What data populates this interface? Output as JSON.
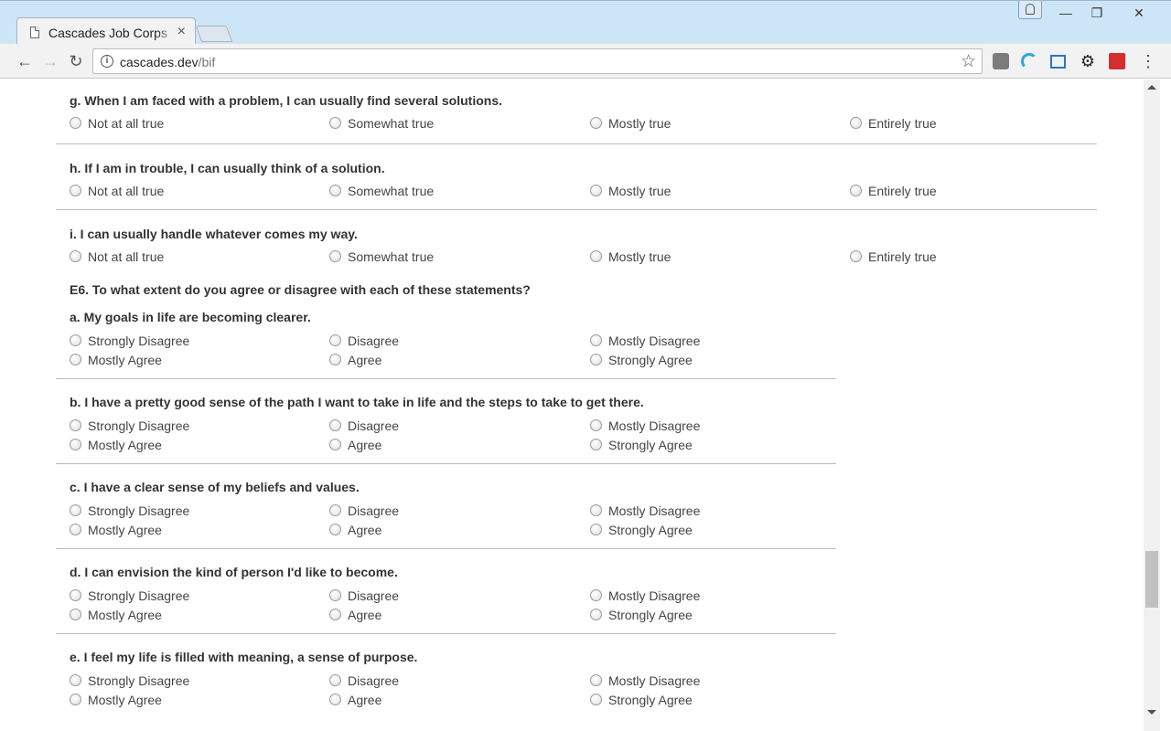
{
  "browser": {
    "tab_title": "Cascades Job Corps",
    "tab_close": "×",
    "url_host": "cascades.dev",
    "url_path": "/bif",
    "window_buttons": {
      "minimize": "—",
      "maximize": "❐",
      "close": "✕"
    },
    "star_icon": "☆",
    "back_icon": "←",
    "forward_icon": "→",
    "reload_icon": "↻",
    "menu_icon": "⋮"
  },
  "frequency_options": [
    "Not at all true",
    "Somewhat true",
    "Mostly true",
    "Entirely true"
  ],
  "agree_options": [
    "Strongly Disagree",
    "Disagree",
    "Mostly Disagree",
    "Mostly Agree",
    "Agree",
    "Strongly Agree"
  ],
  "e5_questions": [
    {
      "text": "g. When I am faced with a problem, I can usually find several solutions."
    },
    {
      "text": "h. If I am in trouble, I can usually think of a solution."
    },
    {
      "text": "i. I can usually handle whatever comes my way."
    }
  ],
  "e6": {
    "title": "E6. To what extent do you agree or disagree with each of these statements?",
    "questions": [
      {
        "text": "a. My goals in life are becoming clearer."
      },
      {
        "text": "b. I have a pretty good sense of the path I want to take in life and the steps to take to get there."
      },
      {
        "text": "c. I have a clear sense of my beliefs and values."
      },
      {
        "text": "d. I can envision the kind of person I'd like to become."
      },
      {
        "text": "e. I feel my life is filled with meaning, a sense of purpose."
      }
    ]
  },
  "colors": {
    "titlebar": "#cde6f7",
    "divider": "#bbbbbb",
    "text": "#333333",
    "ext_red": "#d32f2f",
    "ext_blue": "#29a8e0"
  }
}
